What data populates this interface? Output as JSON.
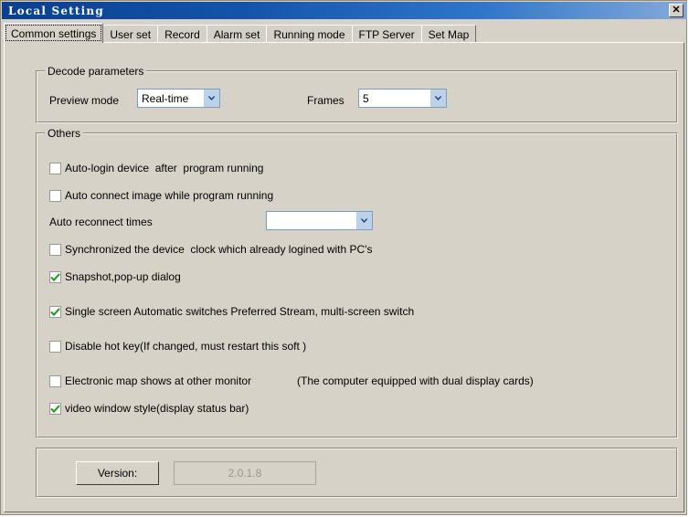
{
  "window": {
    "title": "Local Setting",
    "close_label": "✕"
  },
  "tabs": [
    {
      "label": "Common settings",
      "active": true
    },
    {
      "label": "User set",
      "active": false
    },
    {
      "label": "Record",
      "active": false
    },
    {
      "label": "Alarm set",
      "active": false
    },
    {
      "label": "Running mode",
      "active": false
    },
    {
      "label": "FTP Server",
      "active": false
    },
    {
      "label": "Set Map",
      "active": false
    }
  ],
  "decode_group": {
    "title": "Decode parameters",
    "preview_mode_label": "Preview mode",
    "preview_mode_value": "Real-time",
    "frames_label": "Frames",
    "frames_value": "5"
  },
  "others_group": {
    "title": "Others",
    "checkboxes": [
      {
        "label": "Auto-login device  after  program running",
        "checked": false
      },
      {
        "label": "Auto connect image while program running",
        "checked": false
      },
      {
        "label": "Synchronized the device  clock which already logined with PC's",
        "checked": false
      },
      {
        "label": "Snapshot,pop-up dialog",
        "checked": true
      },
      {
        "label": "Single screen Automatic switches Preferred Stream, multi-screen switch",
        "checked": true
      },
      {
        "label": "Disable hot key(If changed, must restart this soft )",
        "checked": false
      },
      {
        "label": "Electronic map shows at other monitor",
        "checked": false
      },
      {
        "label": "video window style(display status bar)",
        "checked": true
      }
    ],
    "reconnect_label": "Auto reconnect times",
    "reconnect_value": "",
    "dual_display_note": "(The computer equipped with dual display cards)"
  },
  "version_group": {
    "button_label": "Version:",
    "value": "2.0.1.8"
  },
  "colors": {
    "title_bar_start": "#0b3f8f",
    "title_bar_end": "#86a9d8",
    "dialog_face": "#d6d2c8",
    "combo_arrow": "#bcd2ea",
    "check_green": "#1a9b1a",
    "disabled_text": "#9a968e"
  }
}
